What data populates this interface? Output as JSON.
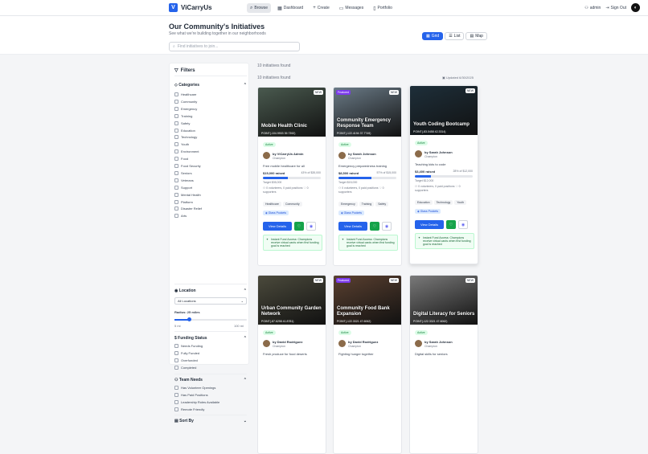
{
  "nav": {
    "brand": "ViCarryUs",
    "links": [
      {
        "label": "Browse",
        "icon": "search-icon"
      },
      {
        "label": "Dashboard",
        "icon": "grid-icon"
      },
      {
        "label": "Create",
        "icon": "plus-icon"
      },
      {
        "label": "Messages",
        "icon": "message-icon"
      },
      {
        "label": "Portfolio",
        "icon": "portfolio-icon"
      }
    ],
    "user": "admin",
    "signout": "Sign Out"
  },
  "hero": {
    "title": "Our Community's Initiatives",
    "subtitle": "See what we're building together in our neighborhoods",
    "search_placeholder": "Find initiatives to join..."
  },
  "views": [
    "Grid",
    "List",
    "Map"
  ],
  "filters": {
    "title": "Filters",
    "categories_title": "Categories",
    "categories": [
      "Healthcare",
      "Community",
      "Emergency",
      "Training",
      "Safety",
      "Education",
      "Technology",
      "Youth",
      "Environment",
      "Food",
      "Food Security",
      "Seniors",
      "Veterans",
      "Support",
      "Mental Health",
      "Platform",
      "Disaster Relief",
      "Arts"
    ],
    "location_title": "Location",
    "location_value": "All Locations",
    "radius_label": "Radius: 25 miles",
    "radius_min": "5 mi",
    "radius_max": "100 mi",
    "radius_fraction": 0.21,
    "funding_title": "Funding Status",
    "funding": [
      "Needs Funding",
      "Fully Funded",
      "Overfunded",
      "Completed"
    ],
    "team_title": "Team Needs",
    "team": [
      "Has Volunteer Openings",
      "Has Paid Positions",
      "Leadership Roles Available",
      "Remote Friendly"
    ],
    "sort_title": "Sort By"
  },
  "counts": {
    "found1": "10 initiatives found",
    "found2": "10 initiatives found",
    "updated": "Updated 6/30/2025"
  },
  "cards": [
    {
      "title": "Mobile Health Clinic",
      "point": "POINT(-104.9903 39.7392)",
      "badge": "NEW",
      "featured": "",
      "status": "Active",
      "by": "by ViCarryUs Admin",
      "role": "Champion",
      "desc": "Free mobile healthcare for all",
      "raised": "$15,000 raised",
      "pct": "43% of $35,000",
      "frac": 0.43,
      "target": "Target $35,000",
      "vol": "0 volunteers, 0 paid positions",
      "sup": "0 supporters",
      "tags": [
        "Healthcare",
        "Community"
      ],
      "glass": "Glass Pockets",
      "vd": "View Details",
      "inst": "Instant Fund Access: Champions receive virtual cards when first funding goal is reached",
      "img": "#4a5a4f"
    },
    {
      "title": "Community Emergency Response Team",
      "point": "POINT(-122.4194 37.7749)",
      "badge": "NEW",
      "featured": "Featured",
      "status": "Active",
      "by": "by Sarah Johnson",
      "role": "Champion",
      "desc": "Emergency preparedness training",
      "raised": "$8,500 raised",
      "pct": "57% of $15,000",
      "frac": 0.57,
      "target": "Target $15,000",
      "vol": "0 volunteers, 0 paid positions",
      "sup": "0 supporters",
      "tags": [
        "Emergency",
        "Training",
        "Safety"
      ],
      "glass": "Glass Pockets",
      "vd": "View Details",
      "inst": "Instant Fund Access: Champions receive virtual cards when first funding goal is reached",
      "img": "#6a7a86"
    },
    {
      "title": "Youth Coding Bootcamp",
      "point": "POINT(-83.0458 42.3314)",
      "badge": "NEW",
      "featured": "",
      "status": "Active",
      "by": "by Sarah Johnson",
      "role": "Champion",
      "desc": "Teaching kids to code",
      "raised": "$3,400 raised",
      "pct": "28% of $12,000",
      "frac": 0.28,
      "target": "Target $12,000",
      "vol": "0 volunteers, 0 paid positions",
      "sup": "0 supporters",
      "tags": [
        "Education",
        "Technology",
        "Youth"
      ],
      "glass": "Glass Pockets",
      "vd": "View Details",
      "inst": "Instant Fund Access: Champions receive virtual cards when first funding goal is reached",
      "img": "#1e2f3a"
    },
    {
      "title": "Urban Community Garden Network",
      "point": "POINT(-87.6298 41.8781)",
      "badge": "NEW",
      "featured": "",
      "status": "Active",
      "by": "by David Rodriguez",
      "role": "Champion",
      "desc": "Fresh produce for food deserts",
      "img": "#4b4a3c"
    },
    {
      "title": "Community Food Bank Expansion",
      "point": "POINT(-122.3321 47.6062)",
      "badge": "NEW",
      "featured": "Featured",
      "status": "Active",
      "by": "by David Rodriguez",
      "role": "Champion",
      "desc": "Fighting hunger together",
      "img": "#5a4030"
    },
    {
      "title": "Digital Literacy for Seniors",
      "point": "POINT(-122.3321 47.6062)",
      "badge": "NEW",
      "featured": "",
      "status": "Active",
      "by": "by Sarah Johnson",
      "role": "Champion",
      "desc": "Digital skills for seniors",
      "img": "#7a7a7a"
    }
  ]
}
